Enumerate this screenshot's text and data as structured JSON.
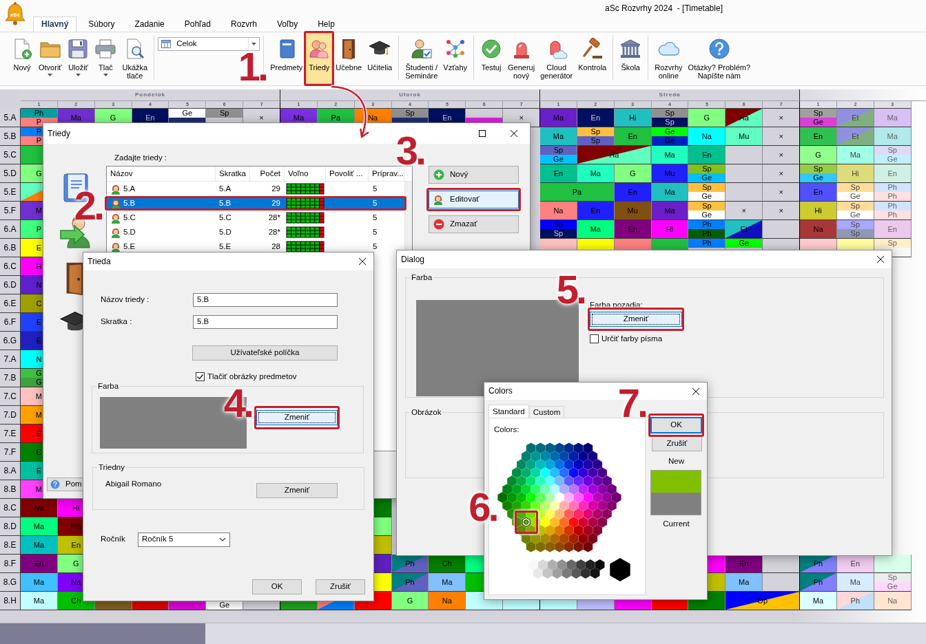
{
  "window": {
    "title": "aSc Rozvrhy 2024  - [Timetable]",
    "logo_text": "aSc"
  },
  "ribbon": {
    "tabs": [
      {
        "label": "Hlavný",
        "selected": true
      },
      {
        "label": "Súbory",
        "selected": false
      },
      {
        "label": "Zadanie",
        "selected": false
      },
      {
        "label": "Pohľad",
        "selected": false
      },
      {
        "label": "Rozvrh",
        "selected": false
      },
      {
        "label": "Voľby",
        "selected": false
      },
      {
        "label": "Help",
        "selected": false
      }
    ],
    "groups": [
      [
        {
          "kind": "button",
          "label": "Nový",
          "dropdown": false,
          "selected": false
        },
        {
          "kind": "button",
          "label": "Otvoriť",
          "dropdown": true,
          "selected": false
        },
        {
          "kind": "button",
          "label": "Uložiť",
          "dropdown": true,
          "selected": false
        },
        {
          "kind": "button",
          "label": "Tlač",
          "dropdown": true,
          "selected": false
        },
        {
          "kind": "button",
          "label": "Ukážka\ntlače",
          "dropdown": false,
          "selected": false
        }
      ],
      [
        {
          "kind": "combo",
          "value": "Celok"
        }
      ],
      [
        {
          "kind": "button",
          "label": "Predmety",
          "dropdown": false,
          "selected": false
        },
        {
          "kind": "button",
          "label": "Triedy",
          "dropdown": false,
          "selected": true,
          "step": "1."
        },
        {
          "kind": "button",
          "label": "Učebne",
          "dropdown": false,
          "selected": false
        },
        {
          "kind": "button",
          "label": "Učitelia",
          "dropdown": false,
          "selected": false
        }
      ],
      [
        {
          "kind": "button",
          "label": "Študenti /\nSemináre",
          "dropdown": false,
          "selected": false
        },
        {
          "kind": "button",
          "label": "Vzťahy",
          "dropdown": false,
          "selected": false
        }
      ],
      [
        {
          "kind": "button",
          "label": "Testuj",
          "dropdown": false,
          "selected": false
        },
        {
          "kind": "button",
          "label": "Generuj\nnový",
          "dropdown": false,
          "selected": false
        },
        {
          "kind": "button",
          "label": "Cloud\ngenerátor",
          "dropdown": false,
          "selected": false
        },
        {
          "kind": "button",
          "label": "Kontrola",
          "dropdown": false,
          "selected": false
        }
      ],
      [
        {
          "kind": "button",
          "label": "Škola",
          "dropdown": false,
          "selected": false
        }
      ],
      [
        {
          "kind": "button",
          "label": "Rozvrhy\nonline",
          "dropdown": false,
          "selected": false
        },
        {
          "kind": "button",
          "label": "Otázky? Problém?\nNapíšte nám",
          "dropdown": false,
          "selected": false
        }
      ]
    ]
  },
  "timetable": {
    "days": [
      {
        "name": "Pondelok",
        "periods": [
          "1",
          "2",
          "3",
          "4",
          "5",
          "6",
          "7"
        ]
      },
      {
        "name": "Utorok",
        "periods": [
          "1",
          "2",
          "3",
          "4",
          "5",
          "6",
          "7"
        ]
      },
      {
        "name": "Streda",
        "periods": [
          "1",
          "2",
          "3",
          "4",
          "5",
          "6",
          "7"
        ]
      },
      {
        "periods": [
          "1",
          "2",
          "3"
        ]
      }
    ],
    "rows": [
      {
        "label": "5.A",
        "cells": [
          {
            "kind": "split",
            "top": {
              "text": "Ph",
              "color": "#00a0a0"
            },
            "bottom": {
              "text": "P",
              "color": "#ff8080"
            }
          },
          {
            "kind": "lesson",
            "text": "Ma",
            "color": "#7030d0"
          },
          {
            "kind": "lesson",
            "text": "G",
            "color": "#80ff80"
          },
          {
            "kind": "lesson",
            "text": "En",
            "color": "#001060"
          },
          {
            "kind": "split",
            "top": {
              "text": "Ge",
              "color": "#ffffff"
            },
            "bottom": {
              "color": "#203070"
            }
          },
          {
            "kind": "split",
            "top": {
              "text": "Sp",
              "color": "#909090"
            },
            "bottom": {
              "color": "#d0d0d8"
            }
          },
          {
            "kind": "blocked",
            "text": "×"
          },
          {
            "kind": "lesson",
            "text": "Ma",
            "color": "#7a30e0"
          },
          {
            "kind": "lesson",
            "text": "Pa",
            "color": "#20c040"
          },
          {
            "kind": "lesson",
            "text": "Na",
            "color": "#ff8000"
          },
          {
            "kind": "split",
            "top": {
              "text": "Sp",
              "color": "#909090"
            },
            "bottom": {
              "color": "#203070"
            }
          },
          {
            "kind": "lesson",
            "text": "En",
            "color": "#001060"
          },
          {
            "kind": "split",
            "top": {
              "color": "#d0d0d8"
            },
            "bottom": {
              "color": "#e020e0"
            }
          },
          {
            "kind": "blocked",
            "text": "×"
          },
          {
            "kind": "lesson",
            "text": "Ma",
            "color": "#6a1fc8"
          },
          {
            "kind": "lesson",
            "text": "En",
            "color": "#001060"
          },
          {
            "kind": "lesson",
            "text": "Hi",
            "color": "#20c0c0"
          },
          {
            "kind": "split",
            "top": {
              "text": "Sp",
              "color": "#909090"
            },
            "bottom": {
              "text": "Sp",
              "color": "#001060"
            }
          },
          {
            "kind": "lesson",
            "text": "G",
            "color": "#80ff80"
          },
          {
            "kind": "diagonal",
            "text": "Ha",
            "color": "#800000",
            "lower": {
              "color": "#60ffc0"
            }
          },
          {
            "kind": "blocked",
            "text": "×"
          },
          {
            "kind": "split",
            "top": {
              "text": "Sp",
              "color": "#a0a0a0"
            },
            "bottom": {
              "text": "Ge",
              "color": "#d840d8"
            }
          },
          {
            "kind": "diagonal",
            "text": "Et",
            "color": "#9090e0",
            "lower": {
              "color": "#80b080"
            }
          },
          {
            "kind": "lesson",
            "text": "Ma",
            "color": "#d8c0f4"
          }
        ]
      },
      {
        "label": "5.B",
        "cells": [
          {
            "kind": "split",
            "top": {
              "text": "P",
              "color": "#0080ff"
            },
            "bottom": {
              "text": "P",
              "color": "#ff8080"
            }
          },
          null,
          null,
          null,
          null,
          null,
          null,
          null,
          null,
          null,
          null,
          null,
          null,
          null,
          {
            "kind": "lesson",
            "text": "Ma",
            "color": "#20c0c0"
          },
          {
            "kind": "split",
            "top": {
              "text": "Sp",
              "color": "#ffc040"
            },
            "bottom": {
              "text": "Sp",
              "color": "#6060c0"
            }
          },
          {
            "kind": "lesson",
            "text": "En",
            "color": "#20c040"
          },
          {
            "kind": "split",
            "top": {
              "text": "Ge",
              "color": "#00ff00"
            },
            "bottom": {
              "text": "Ge",
              "color": "#0020c0"
            }
          },
          {
            "kind": "lesson",
            "text": "Na",
            "color": "#00ffff"
          },
          {
            "kind": "lesson",
            "text": "Mu",
            "color": "#60ffc0"
          },
          {
            "kind": "blocked",
            "text": "×"
          },
          {
            "kind": "lesson",
            "text": "En",
            "color": "#30c050"
          },
          {
            "kind": "diagonal",
            "text": "Et",
            "color": "#9090e0",
            "lower": {
              "color": "#80b080"
            }
          },
          {
            "kind": "lesson",
            "text": "Ma",
            "color": "#b0eaea"
          }
        ]
      },
      {
        "label": "5.C",
        "cells": [
          {
            "kind": "lesson",
            "color": "#20c040"
          },
          null,
          null,
          null,
          null,
          null,
          null,
          null,
          null,
          null,
          null,
          null,
          null,
          null,
          {
            "kind": "split",
            "top": {
              "text": "Sp",
              "color": "#6060c0"
            },
            "bottom": {
              "text": "Ge",
              "color": "#00c0ff"
            }
          },
          {
            "kind": "diagonal",
            "text": "Ha",
            "color": "#800000",
            "lower": {
              "color": "#60ffc0"
            },
            "wide": true
          },
          null,
          {
            "kind": "lesson",
            "text": "Ma",
            "color": "#20ffc0"
          },
          {
            "kind": "lesson",
            "text": "En",
            "color": "#00c090"
          },
          {
            "kind": "free"
          },
          {
            "kind": "blocked",
            "text": "×"
          },
          {
            "kind": "lesson",
            "text": "G",
            "color": "#90ff90"
          },
          {
            "kind": "lesson",
            "text": "Ma",
            "color": "#a0ffe4"
          },
          {
            "kind": "split",
            "top": {
              "text": "Sp",
              "color": "#dcdcf8"
            },
            "bottom": {
              "text": "Ge",
              "color": "#c0f0ff"
            }
          }
        ]
      },
      {
        "label": "5.D",
        "cells": [
          {
            "kind": "lesson",
            "text": "G",
            "color": "#80ff80"
          },
          null,
          null,
          null,
          null,
          null,
          null,
          null,
          null,
          null,
          null,
          null,
          null,
          null,
          {
            "kind": "lesson",
            "text": "En",
            "color": "#00c090"
          },
          {
            "kind": "lesson",
            "text": "Ma",
            "color": "#20ffc0"
          },
          {
            "kind": "lesson",
            "text": "G",
            "color": "#80ff80"
          },
          {
            "kind": "lesson",
            "text": "Mu",
            "color": "#2020ff"
          },
          {
            "kind": "split",
            "top": {
              "text": "Sp",
              "color": "#80c020"
            },
            "bottom": {
              "text": "Ge",
              "color": "#00c0ff"
            }
          },
          {
            "kind": "free"
          },
          {
            "kind": "blocked",
            "text": "×"
          },
          {
            "kind": "split",
            "top": {
              "text": "Sp",
              "color": "#98cc48"
            },
            "bottom": {
              "text": "Ge",
              "color": "#30c8ff"
            }
          },
          {
            "kind": "lesson",
            "text": "Hi",
            "color": "#dcdc78"
          },
          {
            "kind": "lesson",
            "text": "En",
            "color": "#d0f0e4"
          }
        ]
      },
      {
        "label": "5.E",
        "cells": [
          {
            "kind": "diagonal",
            "color": "#60ffc0",
            "lower": {
              "color": "#ff8000"
            }
          },
          null,
          null,
          null,
          null,
          null,
          null,
          null,
          null,
          null,
          null,
          null,
          null,
          null,
          {
            "kind": "lesson",
            "text": "Pa",
            "color": "#20c040",
            "wide": true
          },
          null,
          {
            "kind": "lesson",
            "text": "En",
            "color": "#2020ff"
          },
          {
            "kind": "lesson",
            "text": "Ma",
            "color": "#20c0c0"
          },
          {
            "kind": "split",
            "top": {
              "text": "Sp",
              "color": "#ffc040"
            },
            "bottom": {
              "text": "Ge",
              "color": "#ffffff"
            }
          },
          {
            "kind": "free"
          },
          {
            "kind": "blocked",
            "text": "×"
          },
          {
            "kind": "lesson",
            "text": "En",
            "color": "#5050ff"
          },
          {
            "kind": "split",
            "top": {
              "text": "Sp",
              "color": "#ffdc98"
            },
            "bottom": {
              "text": "Ge",
              "color": "#ffffff"
            }
          },
          {
            "kind": "split",
            "top": {
              "text": "Ph",
              "color": "#d0e4ff"
            },
            "bottom": {
              "text": "Ph",
              "color": "#ffe0e0"
            }
          }
        ]
      },
      {
        "label": "5.F",
        "cells": [
          {
            "kind": "lesson",
            "text": "M",
            "color": "#7030d0"
          },
          null,
          null,
          null,
          null,
          null,
          null,
          null,
          null,
          null,
          null,
          null,
          null,
          null,
          {
            "kind": "lesson",
            "text": "Na",
            "color": "#ff8080"
          },
          {
            "kind": "lesson",
            "text": "En",
            "color": "#2020ff"
          },
          {
            "kind": "lesson",
            "text": "Mu",
            "color": "#805010"
          },
          {
            "kind": "lesson",
            "text": "Ma",
            "color": "#6a1fc8"
          },
          {
            "kind": "split",
            "top": {
              "text": "Sp",
              "color": "#ffc040"
            },
            "bottom": {
              "text": "Ge",
              "color": "#ffffff"
            }
          },
          {
            "kind": "blocked",
            "text": "×"
          },
          {
            "kind": "blocked",
            "text": "×"
          },
          {
            "kind": "lesson",
            "text": "Hi",
            "color": "#cccc30"
          },
          {
            "kind": "split",
            "top": {
              "text": "Sp",
              "color": "#ffdc98"
            },
            "bottom": {
              "text": "Ge",
              "color": "#ffffff"
            }
          },
          {
            "kind": "split",
            "top": {
              "text": "Ph",
              "color": "#d0e4ff"
            },
            "bottom": {
              "text": "Ph",
              "color": "#ffe0e0"
            }
          }
        ]
      },
      {
        "label": "6.A",
        "cells": [
          {
            "kind": "lesson",
            "text": "P",
            "color": "#40ff80"
          },
          null,
          null,
          null,
          null,
          null,
          null,
          null,
          null,
          null,
          null,
          null,
          null,
          null,
          {
            "kind": "split",
            "top": {
              "text": "Sp",
              "color": "#0000ff"
            },
            "bottom": {
              "text": "Sp",
              "color": "#001060"
            }
          },
          {
            "kind": "lesson",
            "text": "Ma",
            "color": "#00ff80"
          },
          {
            "kind": "lesson",
            "text": "En",
            "color": "#800080"
          },
          {
            "kind": "lesson",
            "text": "Hi",
            "color": "#ff00ff"
          },
          {
            "kind": "split",
            "top": {
              "text": "Ph",
              "color": "#0080ff"
            },
            "bottom": {
              "text": "Ph",
              "color": "#006000"
            }
          },
          {
            "kind": "diagonal",
            "text": "Et",
            "color": "#20c0c0",
            "lower": {
              "color": "#1010c0"
            }
          },
          {
            "kind": "free"
          },
          {
            "kind": "lesson",
            "text": "Na",
            "color": "#a83838"
          },
          {
            "kind": "split",
            "top": {
              "text": "Sp",
              "color": "#a8a8ff"
            },
            "bottom": {
              "text": "Sp",
              "color": "#9098b8"
            }
          },
          {
            "kind": "lesson",
            "text": "En",
            "color": "#ecc8ec"
          }
        ]
      },
      {
        "label": "6.B",
        "cells": [
          {
            "kind": "lesson",
            "text": "E",
            "color": "#ffff00"
          },
          null,
          null,
          null,
          null,
          null,
          null,
          null,
          null,
          null,
          null,
          null,
          null,
          null,
          {
            "kind": "lesson",
            "color": "#ffc0c0"
          },
          {
            "kind": "lesson",
            "color": "#ffff00"
          },
          {
            "kind": "lesson",
            "color": "#ff8080"
          },
          {
            "kind": "lesson",
            "color": "#20c040"
          },
          {
            "kind": "split",
            "top": {
              "text": "Ph",
              "color": "#0080ff"
            }
          },
          {
            "kind": "split",
            "top": {
              "text": "Ge",
              "color": "#00ff00"
            }
          },
          {
            "kind": "free"
          },
          {
            "kind": "lesson",
            "color": "#ffcccc"
          },
          {
            "kind": "lesson",
            "color": "#ffffa0"
          },
          {
            "kind": "split",
            "top": {
              "text": "Sp",
              "color": "#fff0c8"
            }
          }
        ]
      },
      {
        "label": "6.C",
        "cells": [
          {
            "kind": "lesson",
            "text": "H",
            "color": "#ff00ff"
          }
        ]
      },
      {
        "label": "6.D",
        "cells": [
          {
            "kind": "lesson",
            "text": "N",
            "color": "#6020d0"
          }
        ]
      },
      {
        "label": "6.E",
        "cells": [
          {
            "kind": "lesson",
            "text": "C",
            "color": "#a0a000"
          }
        ]
      },
      {
        "label": "6.F",
        "cells": [
          {
            "kind": "lesson",
            "text": "E",
            "color": "#2040ff"
          }
        ]
      },
      {
        "label": "6.G",
        "cells": [
          {
            "kind": "lesson",
            "text": "E",
            "color": "#2020c0"
          }
        ]
      },
      {
        "label": "7.A",
        "cells": [
          {
            "kind": "lesson",
            "text": "N",
            "color": "#00ffff"
          }
        ]
      },
      {
        "label": "7.B",
        "cells": [
          {
            "kind": "split",
            "top": {
              "text": "G",
              "color": "#40c040"
            },
            "bottom": {
              "text": "G",
              "color": "#40a040"
            }
          }
        ]
      },
      {
        "label": "7.C",
        "cells": [
          {
            "kind": "lesson",
            "text": "M",
            "color": "#ffc0c0"
          }
        ]
      },
      {
        "label": "7.D",
        "cells": [
          {
            "kind": "lesson",
            "text": "M",
            "color": "#ffa000"
          }
        ]
      },
      {
        "label": "7.E",
        "cells": [
          {
            "kind": "lesson",
            "text": "E",
            "color": "#ff0000"
          }
        ]
      },
      {
        "label": "7.F",
        "cells": [
          {
            "kind": "lesson",
            "text": "C",
            "color": "#008000"
          }
        ]
      },
      {
        "label": "8.A",
        "cells": [
          {
            "kind": "lesson",
            "text": "E",
            "color": "#00c0a0"
          }
        ]
      },
      {
        "label": "8.B",
        "cells": [
          {
            "kind": "lesson",
            "text": "M",
            "color": "#ff40ff"
          }
        ]
      },
      {
        "label": "8.C",
        "cells": [
          {
            "kind": "lesson",
            "text": "Na",
            "color": "#800000"
          },
          {
            "kind": "lesson",
            "text": "Hi",
            "color": "#ff00ff"
          },
          null,
          null,
          null,
          null,
          null,
          null,
          null,
          {
            "kind": "lesson",
            "color": "#008000"
          }
        ]
      },
      {
        "label": "8.D",
        "cells": [
          {
            "kind": "lesson",
            "text": "Ma",
            "color": "#00ff80"
          },
          {
            "kind": "lesson",
            "text": "Na",
            "color": "#800000"
          },
          null,
          null,
          null,
          null,
          null,
          null,
          null,
          {
            "kind": "lesson",
            "color": "#80ff80"
          }
        ]
      },
      {
        "label": "8.E",
        "cells": [
          {
            "kind": "lesson",
            "text": "Ma",
            "color": "#00c0c0"
          },
          {
            "kind": "lesson",
            "text": "En",
            "color": "#c0c000"
          },
          null,
          null,
          null,
          null,
          null,
          null,
          null,
          {
            "kind": "lesson",
            "color": "#c0c000"
          }
        ]
      },
      {
        "label": "8.F",
        "cells": [
          {
            "kind": "lesson",
            "text": "En",
            "color": "#800080"
          },
          {
            "kind": "lesson",
            "text": "G",
            "color": "#80ff80"
          },
          null,
          null,
          null,
          null,
          null,
          null,
          null,
          {
            "kind": "lesson",
            "color": "#6020c0"
          },
          {
            "kind": "diagonal",
            "text": "Ph",
            "color": "#008080",
            "lower": {
              "color": "#6060c0"
            }
          },
          {
            "kind": "lesson",
            "text": "Ch",
            "color": "#008000"
          },
          {
            "kind": "lesson",
            "color": "#00ff80"
          },
          null,
          null,
          null,
          null,
          null,
          {
            "kind": "lesson",
            "color": "#ff00ff"
          },
          {
            "kind": "lesson",
            "text": "En",
            "color": "#800080"
          },
          {
            "kind": "free"
          },
          {
            "kind": "diagonal",
            "text": "Ph",
            "color": "#008080",
            "lower": {
              "color": "#8080ff"
            }
          },
          {
            "kind": "lesson",
            "text": "En",
            "color": "#f0ccf0"
          },
          {
            "kind": "lesson",
            "color": "#d8ffec"
          }
        ]
      },
      {
        "label": "8.G",
        "cells": [
          {
            "kind": "lesson",
            "text": "Ma",
            "color": "#40c0ff"
          },
          {
            "kind": "lesson",
            "text": "Na",
            "color": "#8000ff"
          },
          null,
          null,
          null,
          null,
          null,
          null,
          null,
          {
            "kind": "lesson",
            "color": "#ffff00"
          },
          {
            "kind": "diagonal",
            "text": "Ph",
            "color": "#008080",
            "lower": {
              "color": "#6060c0"
            }
          },
          {
            "kind": "lesson",
            "text": "Ma",
            "color": "#80c0ff"
          },
          {
            "kind": "lesson",
            "color": "#00c000"
          },
          null,
          null,
          null,
          null,
          null,
          {
            "kind": "lesson",
            "color": "#c0c000"
          },
          {
            "kind": "lesson",
            "text": "Ma",
            "color": "#80c0ff"
          },
          {
            "kind": "free"
          },
          {
            "kind": "diagonal",
            "text": "Ph",
            "color": "#008080",
            "lower": {
              "color": "#8080ff"
            }
          },
          {
            "kind": "lesson",
            "text": "Ma",
            "color": "#d8ecff"
          },
          {
            "kind": "split",
            "top": {
              "text": "Sp",
              "color": "#ececec"
            },
            "bottom": {
              "text": "Ge",
              "color": "#ffd8ff"
            }
          }
        ]
      },
      {
        "label": "8.H",
        "cells": [
          {
            "kind": "lesson",
            "text": "Ma",
            "color": "#c0ffff"
          },
          {
            "kind": "lesson",
            "text": "Ch",
            "color": "#00c000"
          },
          {
            "kind": "lesson",
            "color": "#806020"
          },
          {
            "kind": "lesson",
            "color": "#e00000"
          },
          {
            "kind": "lesson",
            "color": "#e000e0"
          },
          {
            "kind": "split",
            "bottom": {
              "text": "Ge",
              "color": "#ffffff"
            }
          },
          {
            "kind": "free"
          },
          {
            "kind": "lesson",
            "color": "#20a020"
          },
          {
            "kind": "diagonal",
            "color": "#ff8080",
            "lower": {
              "color": "#0080ff"
            }
          },
          {
            "kind": "lesson",
            "color": "#ff0000"
          },
          {
            "kind": "lesson",
            "text": "G",
            "color": "#80ff80"
          },
          {
            "kind": "lesson",
            "text": "Na",
            "color": "#ff8000"
          },
          {
            "kind": "lesson",
            "color": "#c0ffff"
          },
          {
            "kind": "lesson",
            "color": "#c0ffff"
          },
          {
            "kind": "lesson",
            "color": "#c0ffff"
          },
          {
            "kind": "lesson",
            "color": "#c0c0ff"
          },
          {
            "kind": "lesson",
            "color": "#ff00ff"
          },
          {
            "kind": "lesson",
            "color": "#ff0000"
          },
          {
            "kind": "lesson",
            "color": "#008000"
          },
          {
            "kind": "diagonal",
            "text": "Op",
            "color": "#0000ff",
            "lower": {
              "color": "#ffc000"
            },
            "wide": true
          },
          null,
          {
            "kind": "lesson",
            "text": "Ma",
            "color": "#dcffff"
          },
          {
            "kind": "diagonal",
            "text": "Ph",
            "color": "#ffd8d8",
            "lower": {
              "color": "#c0e0ff"
            }
          },
          {
            "kind": "lesson",
            "text": "Na",
            "color": "#ffe4d0"
          }
        ]
      }
    ]
  },
  "classes_dialog": {
    "title": "Triedy",
    "can_maximize": true,
    "prompt": "Zadajte triedy :",
    "columns": [
      "Názov",
      "Skratka",
      "Počet",
      "Voľno",
      "Povoliť ...",
      "Príprav..."
    ],
    "rows": [
      {
        "name": "5.A",
        "short": "5.A",
        "count": "29",
        "preparations": "5",
        "selected": false
      },
      {
        "name": "5.B",
        "short": "5.B",
        "count": "29",
        "preparations": "5",
        "selected": true,
        "step": "2."
      },
      {
        "name": "5.C",
        "short": "5.C",
        "count": "28*",
        "preparations": "5",
        "selected": false
      },
      {
        "name": "5.D",
        "short": "5.D",
        "count": "28*",
        "preparations": "5",
        "selected": false
      },
      {
        "name": "5.E",
        "short": "5.E",
        "count": "28",
        "preparations": "5",
        "selected": false
      }
    ],
    "buttons": [
      {
        "kind": "add",
        "label": "Nový",
        "focused": false
      },
      {
        "kind": "edit",
        "label": "Editovať",
        "focused": true,
        "step": "3."
      },
      {
        "kind": "delete",
        "label": "Zmazať",
        "focused": false
      }
    ],
    "help_button": "Pom"
  },
  "class_dialog": {
    "title": "Trieda",
    "fields": [
      {
        "label": "Názov triedy :",
        "value": "5.B"
      },
      {
        "label": "Skratka :",
        "value": "5.B"
      }
    ],
    "custom_fields_button": "Užívateľské políčka",
    "print_pictures": {
      "label": "Tlačiť obrázky predmetov",
      "checked": true
    },
    "color_group": {
      "title": "Farba",
      "color": "#808080",
      "button": {
        "label": "Zmeniť",
        "focused": true,
        "step": "4."
      }
    },
    "teacher_group": {
      "title": "Triedny",
      "teacher": "Abigail Romano",
      "button": {
        "label": "Zmeniť",
        "focused": false
      }
    },
    "grade": {
      "label": "Ročník",
      "value": "Ročník 5"
    },
    "buttons": [
      {
        "label": "OK"
      },
      {
        "label": "Zrušiť"
      }
    ]
  },
  "color_dialog": {
    "title": "Dialog",
    "color_group": {
      "title": "Farba",
      "color": "#808080",
      "background_label": "Farba pozadia:",
      "button": {
        "label": "Zmeniť",
        "focused": true,
        "step": "5."
      },
      "font_color": {
        "label": "Určiť farby písma",
        "checked": false
      }
    },
    "picture_group": {
      "title": "Obrázok"
    }
  },
  "colors_picker": {
    "title": "Colors",
    "tabs": [
      {
        "label": "Standard",
        "selected": true
      },
      {
        "label": "Custom",
        "selected": false
      }
    ],
    "palette_label": "Colors:",
    "step": "6.",
    "buttons": [
      {
        "label": "OK",
        "focused": true,
        "step": "7."
      },
      {
        "label": "Zrušiť",
        "focused": false
      }
    ],
    "new_label": "New",
    "new_swatch": {
      "color": "#80c000"
    },
    "current_swatch": {
      "color": "#808080"
    },
    "current_label": "Current"
  }
}
